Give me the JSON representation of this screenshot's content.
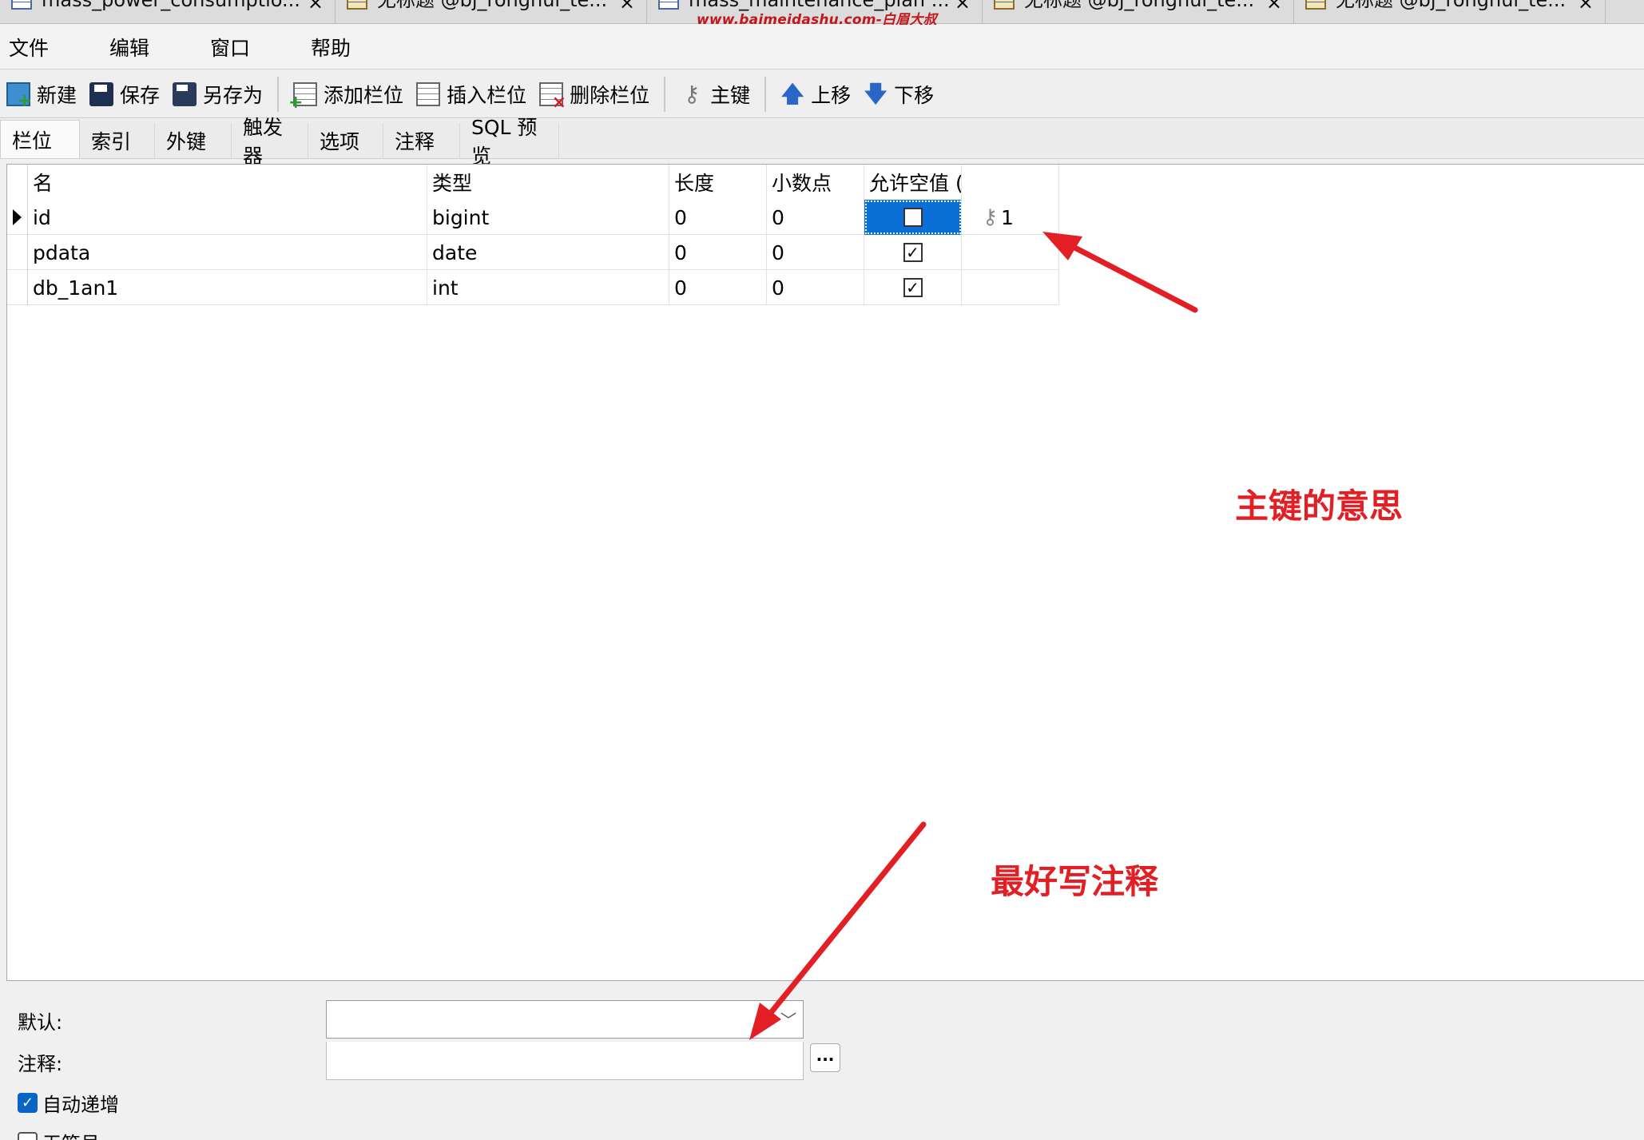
{
  "doc_tabs": [
    {
      "label": "mass_power_consumptio...",
      "icon": "table-icon"
    },
    {
      "label": "无标题 @bj_ronghui_te...",
      "icon": "table-edit-icon"
    },
    {
      "label": "mass_maintenance_plan ...",
      "icon": "table-icon"
    },
    {
      "label": "无标题 @bj_ronghui_te...",
      "icon": "table-edit-icon"
    },
    {
      "label": "无标题 @bj_ronghui_te...",
      "icon": "table-edit-icon"
    }
  ],
  "close_glyph": "×",
  "watermark": "www.baimeidashu.com-白眉大叔",
  "menu": [
    "文件",
    "编辑",
    "窗口",
    "帮助"
  ],
  "toolbar": {
    "new": "新建",
    "save": "保存",
    "save_as": "另存为",
    "add_column": "添加栏位",
    "insert_column": "插入栏位",
    "delete_column": "删除栏位",
    "primary_key": "主键",
    "move_up": "上移",
    "move_down": "下移"
  },
  "tabs": [
    "栏位",
    "索引",
    "外键",
    "触发器",
    "选项",
    "注释",
    "SQL 预览"
  ],
  "table": {
    "headers": [
      "名",
      "类型",
      "长度",
      "小数点",
      "允许空值 (",
      ""
    ],
    "rows": [
      {
        "name": "id",
        "type": "bigint",
        "length": "0",
        "decimals": "0",
        "nullable": false,
        "key": "1"
      },
      {
        "name": "pdata",
        "type": "date",
        "length": "0",
        "decimals": "0",
        "nullable": true,
        "key": ""
      },
      {
        "name": "db_1an1",
        "type": "int",
        "length": "0",
        "decimals": "0",
        "nullable": true,
        "key": ""
      }
    ]
  },
  "annotations": {
    "primary_key_note": "主键的意思",
    "comment_note": "最好写注释",
    "color": "#e11f25"
  },
  "props": {
    "default_label": "默认:",
    "comment_label": "注释:",
    "auto_increment_label": "自动递增",
    "unsigned_label": "无符号",
    "ellipsis": "..."
  },
  "colors": {
    "selection": "#0a6fd6",
    "checkbox_checked": "#0a63c8"
  }
}
